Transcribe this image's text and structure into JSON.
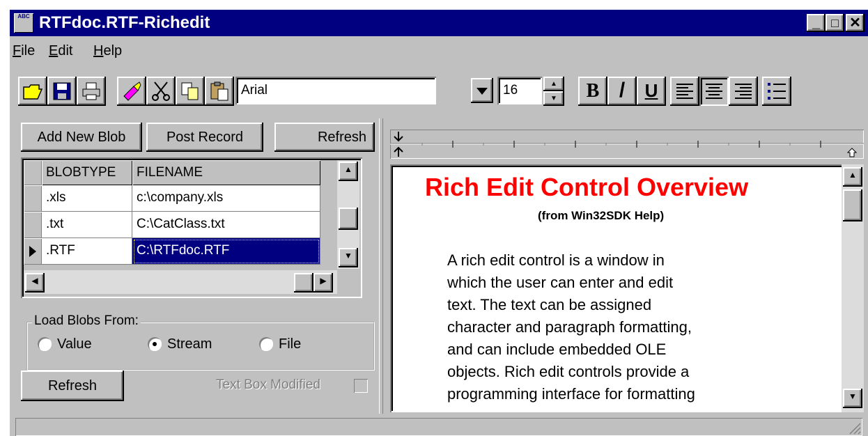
{
  "window": {
    "title": "RTFdoc.RTF-Richedit",
    "app_icon": "ABC",
    "controls": [
      "_",
      "□",
      "✕"
    ]
  },
  "menu": {
    "items": [
      {
        "accel": "F",
        "rest": "ile"
      },
      {
        "accel": "E",
        "rest": "dit"
      },
      {
        "accel": "H",
        "rest": "elp"
      }
    ]
  },
  "toolbar": {
    "font_name": "Arial",
    "font_size": "16",
    "bold": "B",
    "italic": "/",
    "underline": "U",
    "icons": [
      "open-folder-icon",
      "save-disk-icon",
      "print-icon",
      "clear-eraser-icon",
      "cut-scissors-icon",
      "copy-icon",
      "paste-icon",
      "align-left-icon",
      "align-center-icon",
      "align-right-icon",
      "bullets-icon"
    ]
  },
  "left": {
    "buttons": {
      "add": "Add New Blob",
      "post": "Post Record",
      "refresh_top": "Refresh",
      "refresh_bottom": "Refresh"
    },
    "grid": {
      "columns": [
        "BLOBTYPE",
        "FILENAME"
      ],
      "rows": [
        {
          "type": ".xls",
          "file": "c:\\company.xls",
          "current": false
        },
        {
          "type": ".txt",
          "file": "C:\\CatClass.txt",
          "current": false
        },
        {
          "type": ".RTF",
          "file": "C:\\RTFdoc.RTF",
          "current": true
        }
      ]
    },
    "load_group": {
      "label": "Load Blobs From:",
      "options": [
        "Value",
        "Stream",
        "File"
      ],
      "selected": "Stream"
    },
    "modified": {
      "label": "Text Box Modified",
      "checked": false
    }
  },
  "document": {
    "title": "Rich Edit Control Overview",
    "title_color": "#ff0000",
    "subtitle": "(from Win32SDK Help)",
    "lines": [
      "A rich edit control is a window in",
      "which the user can enter and edit",
      "text. The text can be assigned",
      "character and paragraph formatting,",
      "and can include embedded OLE",
      "objects. Rich edit controls provide a",
      "programming interface for formatting"
    ]
  },
  "colors": {
    "titlebar": "#000080",
    "face": "#c0c0c0",
    "selection": "#000080"
  }
}
